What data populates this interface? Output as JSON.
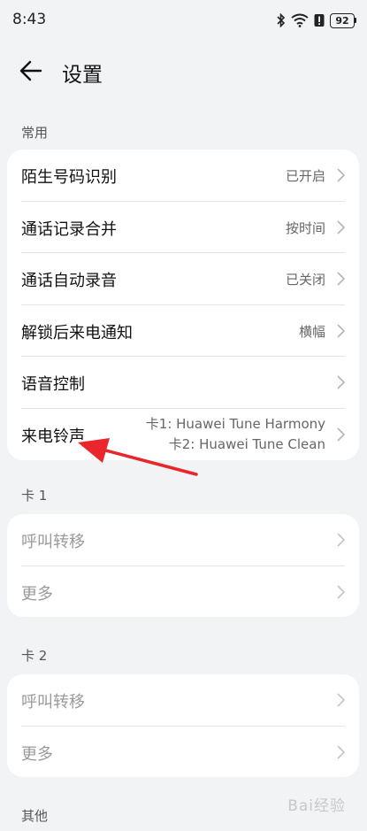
{
  "status_bar": {
    "time": "8:43",
    "battery": "92"
  },
  "header": {
    "title": "设置"
  },
  "sections": {
    "common": {
      "label": "常用",
      "rows": [
        {
          "label": "陌生号码识别",
          "value": "已开启"
        },
        {
          "label": "通话记录合并",
          "value": "按时间"
        },
        {
          "label": "通话自动录音",
          "value": "已关闭"
        },
        {
          "label": "解锁后来电通知",
          "value": "横幅"
        },
        {
          "label": "语音控制",
          "value": ""
        },
        {
          "label": "来电铃声",
          "value_line1": "卡1: Huawei Tune Harmony",
          "value_line2": "卡2: Huawei Tune Clean"
        }
      ]
    },
    "card1": {
      "label": "卡 1",
      "rows": [
        {
          "label": "呼叫转移"
        },
        {
          "label": "更多"
        }
      ]
    },
    "card2": {
      "label": "卡 2",
      "rows": [
        {
          "label": "呼叫转移"
        },
        {
          "label": "更多"
        }
      ]
    },
    "other": {
      "label": "其他"
    }
  },
  "watermark": "Bai经验",
  "colors": {
    "background": "#f1f3f5",
    "card": "#ffffff",
    "annotation_arrow": "#e8262b"
  }
}
